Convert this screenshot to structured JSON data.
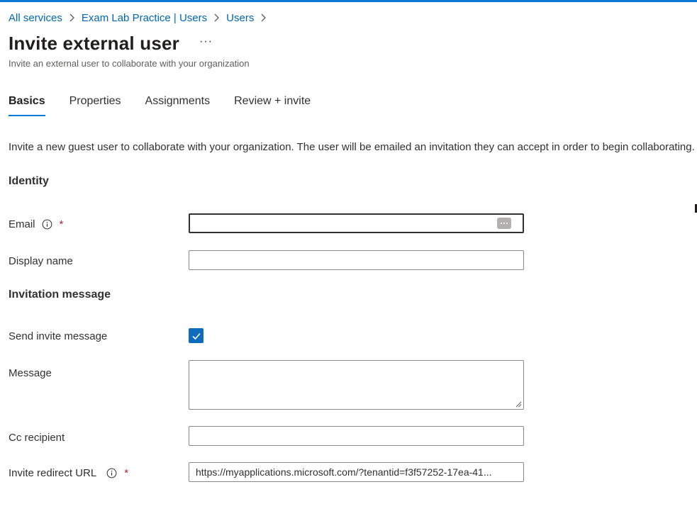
{
  "breadcrumb": {
    "items": [
      "All services",
      "Exam Lab Practice | Users",
      "Users"
    ]
  },
  "page": {
    "title": "Invite external user",
    "more_label": "···",
    "subtitle": "Invite an external user to collaborate with your organization"
  },
  "tabs": [
    {
      "label": "Basics",
      "active": true
    },
    {
      "label": "Properties",
      "active": false
    },
    {
      "label": "Assignments",
      "active": false
    },
    {
      "label": "Review + invite",
      "active": false
    }
  ],
  "intro_text": "Invite a new guest user to collaborate with your organization. The user will be emailed an invitation they can accept in order to begin collaborating.",
  "sections": {
    "identity": "Identity",
    "invitation": "Invitation message"
  },
  "fields": {
    "email": {
      "label": "Email",
      "required_mark": "*",
      "value": ""
    },
    "display_name": {
      "label": "Display name",
      "value": ""
    },
    "send_invite": {
      "label": "Send invite message",
      "checked": true
    },
    "message": {
      "label": "Message",
      "value": ""
    },
    "cc_recipient": {
      "label": "Cc recipient",
      "value": ""
    },
    "redirect_url": {
      "label": "Invite redirect URL",
      "required_mark": "*",
      "value": "https://myapplications.microsoft.com/?tenantid=f3f57252-17ea-41..."
    }
  },
  "colors": {
    "accent": "#0078d4",
    "link": "#0067b8",
    "required": "#a4262c",
    "checkbox": "#0f6cbd"
  },
  "icons": {
    "breadcrumb_separator": "chevron-right-icon",
    "info": "info-icon",
    "password_manager": "password-manager-icon",
    "check": "checkmark-icon"
  }
}
